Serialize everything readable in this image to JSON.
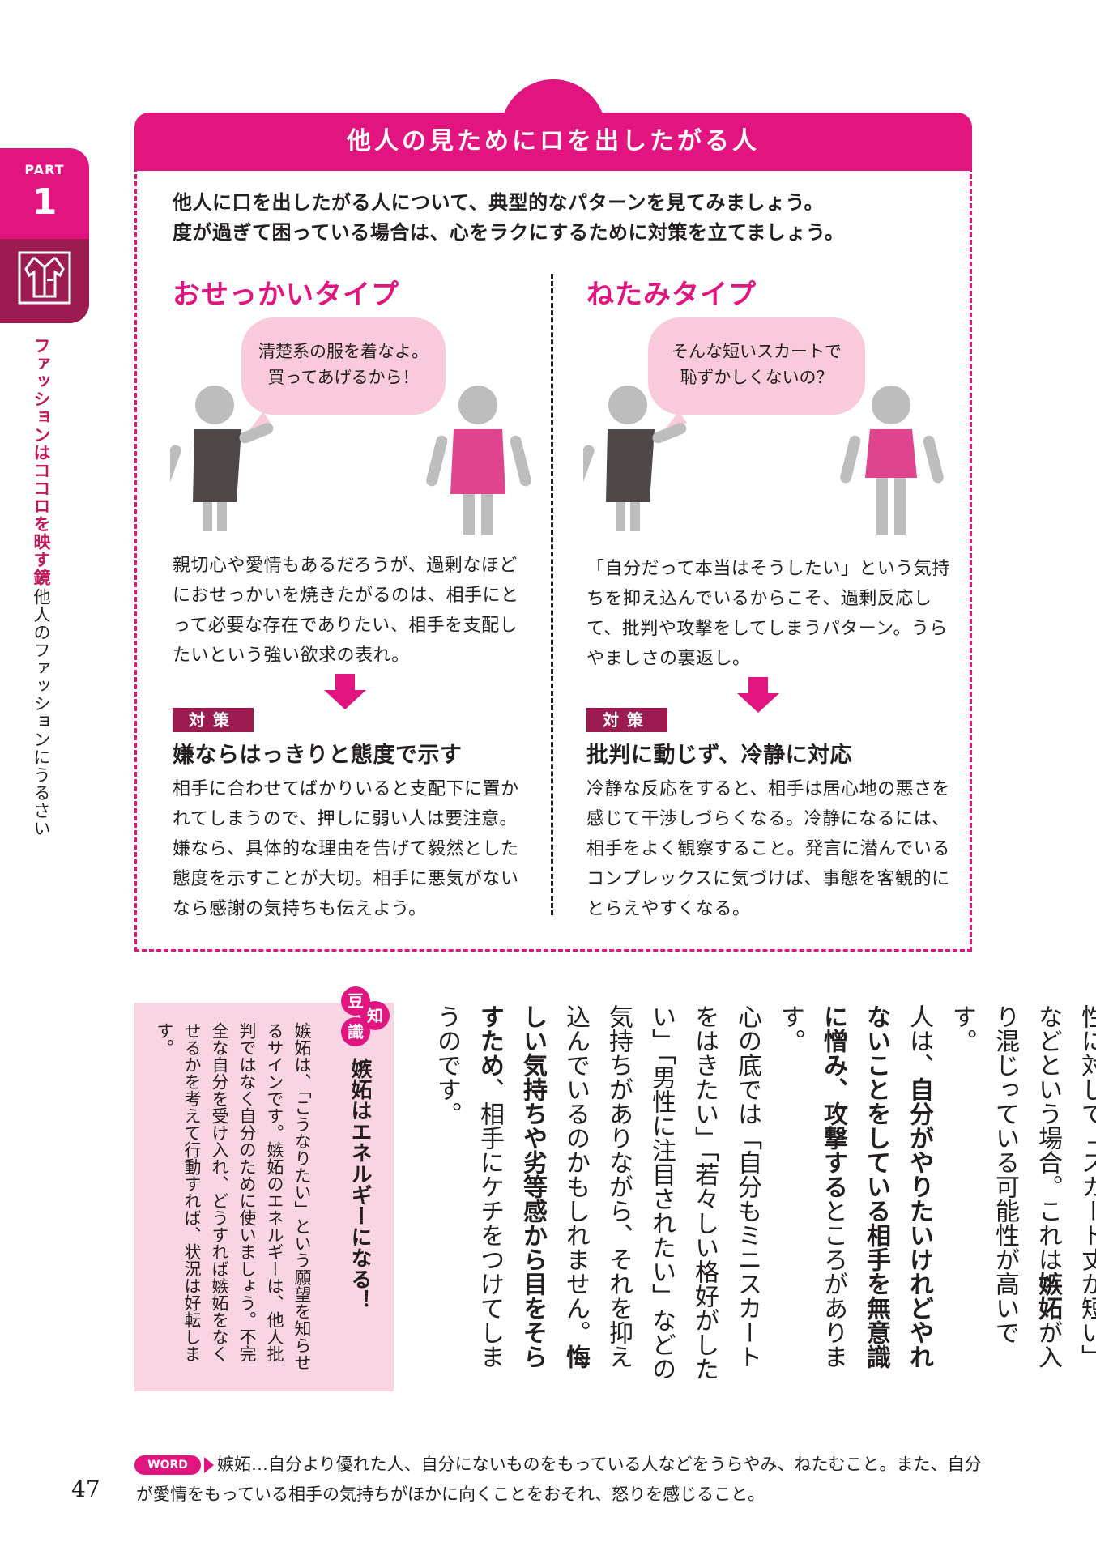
{
  "side_tab": {
    "part_label": "PART",
    "part_number": "1",
    "icon": "shirt-icon"
  },
  "chapter": {
    "title": "ファッションはココロを映す鏡",
    "subtitle": "他人のファッションにうるさい"
  },
  "box": {
    "title": "他人の見ためにロを出したがる人",
    "intro_line1": "他人に口を出したがる人について、典型的なパターンを見てみましょう。",
    "intro_line2": "度が過ぎて困っている場合は、心をラクにするために対策を立てましょう。"
  },
  "left": {
    "type_title": "おせっかいタイプ",
    "bubble_line1": "清楚系の服を着なよ。",
    "bubble_line2": "買ってあげるから！",
    "description": "親切心や愛情もあるだろうが、過剰なほどにおせっかいを焼きたがるのは、相手にとって必要な存在でありたい、相手を支配したいという強い欲求の表れ。",
    "badge": "対策",
    "tactic_title": "嫌ならはっきりと態度で示す",
    "tactic_text": "相手に合わせてばかりいると支配下に置かれてしまうので、押しに弱い人は要注意。嫌なら、具体的な理由を告げて毅然とした態度を示すことが大切。相手に悪気がないなら感謝の気持ちも伝えよう。"
  },
  "right": {
    "type_title": "ねたみタイプ",
    "bubble_line1": "そんな短いスカートで",
    "bubble_line2": "恥ずかしくないの？",
    "description": "「自分だって本当はそうしたい」という気持ちを抑え込んでいるからこそ、過剰反応して、批判や攻撃をしてしまうパターン。うらやましさの裏返し。",
    "badge": "対策",
    "tactic_title": "批判に動じず、冷静に対応",
    "tactic_text": "冷静な反応をすると、相手は居心地の悪さを感じて干渉しづらくなる。冷静になるには、相手をよく観察すること。発言に潜んでいるコンプレックスに気づけば、事態を客観的にとらえやすくなる。"
  },
  "trivia": {
    "label_chars": [
      "豆",
      "知",
      "識"
    ],
    "title": "嫉妬はエネルギーになる！",
    "body": "嫉妬は、「こうなりたい」という願望を知らせるサインです。嫉妬のエネルギーは、他人批判ではなく自分のために使いましょう。不完全な自分を受け入れ、どうすれば嫉妬をなくせるかを考えて行動すれば、状況は好転します。"
  },
  "main_text": {
    "p1_a": "性に対して「スカート丈が短い」などという場合。これは",
    "p1_bold": "嫉妬",
    "p1_b": "が入り混じっている可能性が高いです。",
    "p2_a": "人は、",
    "p2_bold": "自分がやりたいけれどやれないことをしている相手を無意識に憎み、攻撃する",
    "p2_b": "ところがあります。",
    "p3_a": "心の底では「自分もミニスカートをはきたい」「若々しい格好がしたい」「男性に注目されたい」などの気持ちがありながら、それを抑え込んでいるのかもしれません。",
    "p3_bold": "悔しい気持ちや劣等感から目をそらすため",
    "p3_b": "、相手にケチをつけてしまうのです。"
  },
  "footer": {
    "word_badge": "WORD",
    "word_line": "嫉妬…自分より優れた人、自分にないものをもっている人などをうらやみ、ねたむこと。また、自分が愛情をもっている相手の気持ちがほかに向くことをおそれ、怒りを感じること。",
    "page_number": "47"
  },
  "colors": {
    "accent": "#e2147f",
    "dark_accent": "#9c1c52",
    "pink_light": "#f9c9dc",
    "trivia_bg": "#f9d4e3"
  }
}
